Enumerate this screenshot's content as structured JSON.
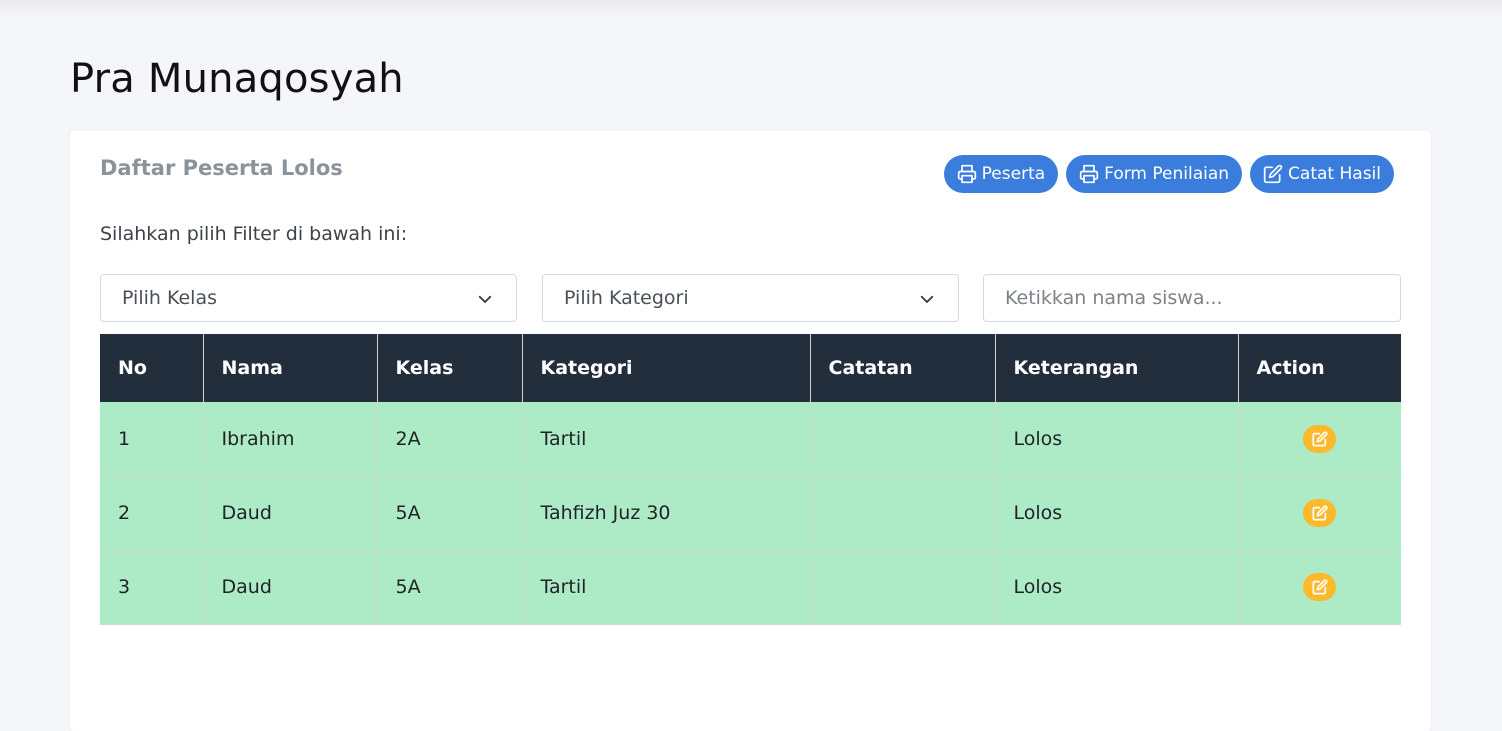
{
  "page": {
    "title": "Pra Munaqosyah"
  },
  "card": {
    "title": "Daftar Peserta Lolos",
    "buttons": [
      {
        "label": "Peserta",
        "icon": "printer-icon"
      },
      {
        "label": "Form Penilaian",
        "icon": "printer-icon"
      },
      {
        "label": "Catat Hasil",
        "icon": "edit-icon"
      }
    ],
    "filter_hint": "Silahkan pilih Filter di bawah ini:"
  },
  "filters": {
    "kelas": {
      "selected": "Pilih Kelas"
    },
    "kategori": {
      "selected": "Pilih Kategori"
    },
    "search": {
      "placeholder": "Ketikkan nama siswa...",
      "value": ""
    }
  },
  "table": {
    "headers": [
      "No",
      "Nama",
      "Kelas",
      "Kategori",
      "Catatan",
      "Keterangan",
      "Action"
    ],
    "rows": [
      {
        "no": "1",
        "nama": "Ibrahim",
        "kelas": "2A",
        "kategori": "Tartil",
        "catatan": "",
        "keterangan": "Lolos"
      },
      {
        "no": "2",
        "nama": "Daud",
        "kelas": "5A",
        "kategori": "Tahfizh Juz 30",
        "catatan": "",
        "keterangan": "Lolos"
      },
      {
        "no": "3",
        "nama": "Daud",
        "kelas": "5A",
        "kategori": "Tartil",
        "catatan": "",
        "keterangan": "Lolos"
      }
    ]
  },
  "colors": {
    "primary": "#3b7ddd",
    "header_bg": "#222e3c",
    "row_success": "#adebc6",
    "action_warning": "#fcb92c",
    "card_title": "#8a929b"
  }
}
